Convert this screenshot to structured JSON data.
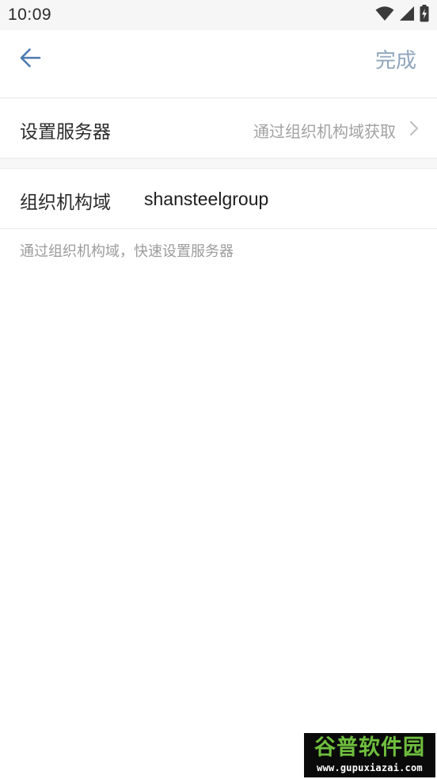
{
  "status_bar": {
    "time": "10:09",
    "icons": [
      "wifi-icon",
      "signal-icon",
      "battery-charging-icon"
    ]
  },
  "toolbar": {
    "back_icon": "arrow-left-icon",
    "done_label": "完成"
  },
  "server_row": {
    "label": "设置服务器",
    "value": "通过组织机构域获取",
    "chevron_icon": "chevron-right-icon"
  },
  "domain_row": {
    "label": "组织机构域",
    "value": "shansteelgroup"
  },
  "hint": "通过组织机构域，快速设置服务器",
  "watermark": {
    "title": "谷普软件园",
    "url": "www.gupuxiazai.com"
  },
  "colors": {
    "accent": "#4a7ab0",
    "done_text": "#8fa6bd",
    "secondary_text": "#a2a2a2",
    "divider": "#e9e9e9"
  }
}
